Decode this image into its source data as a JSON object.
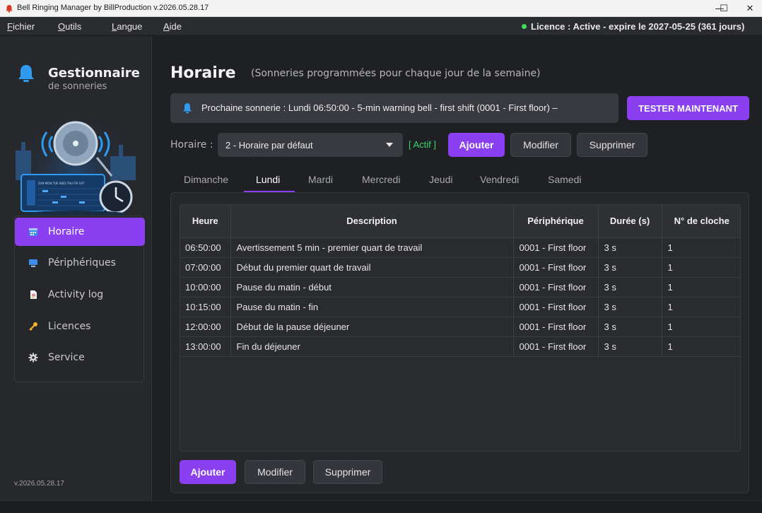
{
  "window": {
    "title": "Bell Ringing Manager by BillProduction  v.2026.05.28.17",
    "minimize": "—",
    "maximize": "☐",
    "close": "✕"
  },
  "menu": {
    "items": [
      {
        "first": "F",
        "rest": "ichier"
      },
      {
        "first": "O",
        "rest": "utils"
      },
      {
        "first": "L",
        "rest": "angue"
      },
      {
        "first": "A",
        "rest": "ide"
      }
    ],
    "licence": "Licence : Active - expire le 2027-05-25 (361 jours)"
  },
  "sidebar": {
    "brand_title": "Gestionnaire",
    "brand_subtitle": "de sonneries",
    "hero_labels": "SUN MON TUE WED THU FRI SAT",
    "items": [
      {
        "label": "Horaire",
        "icon": "calendar-icon"
      },
      {
        "label": "Périphériques",
        "icon": "monitor-icon"
      },
      {
        "label": "Activity log",
        "icon": "document-icon"
      },
      {
        "label": "Licences",
        "icon": "key-icon"
      },
      {
        "label": "Service",
        "icon": "gear-icon"
      }
    ],
    "version": "v.2026.05.28.17"
  },
  "header": {
    "title": "Horaire",
    "subtitle": "(Sonneries programmées pour chaque jour de la semaine)"
  },
  "next_ring": {
    "text": "Prochaine sonnerie : Lundi 06:50:00 - 5-min warning bell - first shift (0001 - First floor) –",
    "test_button": "TESTER MAINTENANT"
  },
  "schedule": {
    "label": "Horaire :",
    "selected": "2 - Horaire par défaut",
    "status": "[ Actif ]",
    "add": "Ajouter",
    "edit": "Modifier",
    "delete": "Supprimer"
  },
  "tabs": [
    "Dimanche",
    "Lundi",
    "Mardi",
    "Mercredi",
    "Jeudi",
    "Vendredi",
    "Samedi"
  ],
  "active_tab": "Lundi",
  "table": {
    "headers": [
      "Heure",
      "Description",
      "Périphérique",
      "Durée (s)",
      "N° de cloche"
    ],
    "rows": [
      [
        "06:50:00",
        "Avertissement 5 min - premier quart de travail",
        "0001 - First floor",
        "3 s",
        "1"
      ],
      [
        "07:00:00",
        "Début du premier quart de travail",
        "0001 - First floor",
        "3 s",
        "1"
      ],
      [
        "10:00:00",
        "Pause du matin - début",
        "0001 - First floor",
        "3 s",
        "1"
      ],
      [
        "10:15:00",
        "Pause du matin - fin",
        "0001 - First floor",
        "3 s",
        "1"
      ],
      [
        "12:00:00",
        "Début de la pause déjeuner",
        "0001 - First floor",
        "3 s",
        "1"
      ],
      [
        "13:00:00",
        "Fin du déjeuner",
        "0001 - First floor",
        "3 s",
        "1"
      ]
    ]
  },
  "bottom": {
    "add": "Ajouter",
    "edit": "Modifier",
    "delete": "Supprimer"
  },
  "colors": {
    "accent": "#8a3ff0",
    "active_green": "#35d66b",
    "background": "#1f2023"
  }
}
